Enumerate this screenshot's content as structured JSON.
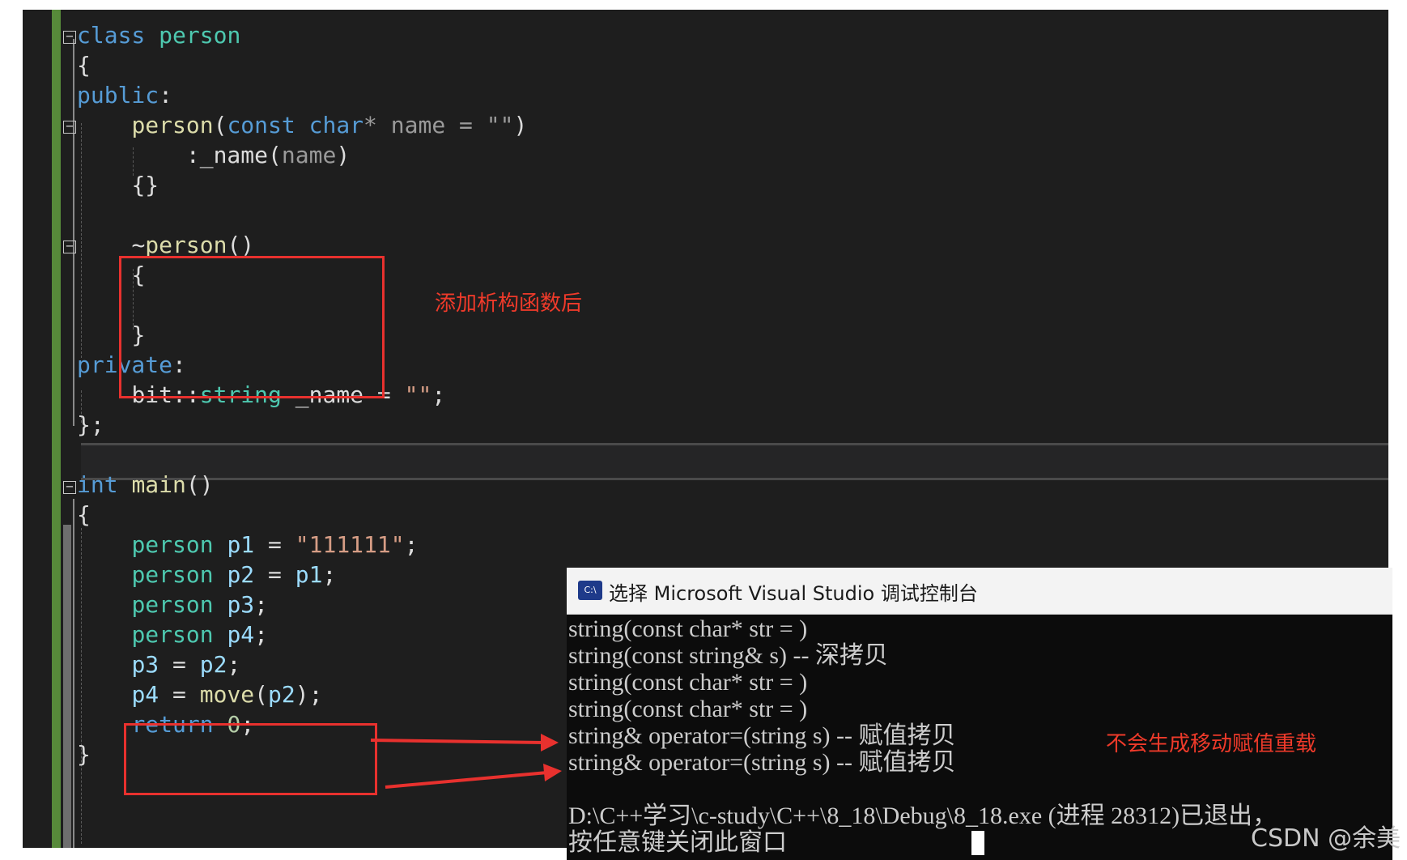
{
  "code": {
    "class_kw": "class",
    "class_name": "person",
    "brace_open": "{",
    "public": "public",
    "colon": ":",
    "ctor_name": "person",
    "lp": "(",
    "const_kw": "const",
    "char_kw": "char",
    "ctor_params_rest": "* name = \"\"",
    "rp": ")",
    "init_prefix": ":_name",
    "init_arg": "name",
    "empty_body": "{}",
    "dtor_tilde": "~",
    "dtor_name": "person",
    "dtor_parens": "()",
    "dtor_open": "{",
    "dtor_close": "}",
    "private": "private",
    "member_ns": "bit::",
    "member_type": "string",
    "member_rest": " _name = ",
    "member_init": "\"\"",
    "semicolon": ";",
    "class_end": "};",
    "int_kw": "int",
    "main_name": "main",
    "main_parens": "()",
    "main_open": "{",
    "p1_var": "p1",
    "p1_eq": " = ",
    "p1_str": "\"111111\"",
    "p2_var": "p2",
    "p2_eq": " = ",
    "p2_from": "p1",
    "p3_var": "p3",
    "p4_var": "p4",
    "assign_p3_lhs": "p3",
    "assign_p3_eq": " = ",
    "assign_p3_rhs": "p2",
    "assign_p4_lhs": "p4",
    "assign_p4_eq": " = ",
    "assign_p4_fn": "move",
    "assign_p4_lp": "(",
    "assign_p4_arg": "p2",
    "assign_p4_rp": ");",
    "return_kw": "return",
    "return_val": "0",
    "main_close": "}"
  },
  "annotations": {
    "destructor_note": "添加析构函数后",
    "no_move_note": "不会生成移动赋值重载"
  },
  "console": {
    "title": "选择 Microsoft Visual Studio 调试控制台",
    "icon_text": "C:\\",
    "lines": [
      "string(const char* str = )",
      "string(const string& s) -- 深拷贝",
      "string(const char* str = )",
      "string(const char* str = )",
      "string& operator=(string s) -- 赋值拷贝",
      "string& operator=(string s) -- 赋值拷贝",
      "",
      "D:\\C++学习\\c-study\\C++\\8_18\\Debug\\8_18.exe (进程 28312)已退出，",
      "按任意键关闭此窗口"
    ]
  },
  "watermark": "CSDN @余美"
}
